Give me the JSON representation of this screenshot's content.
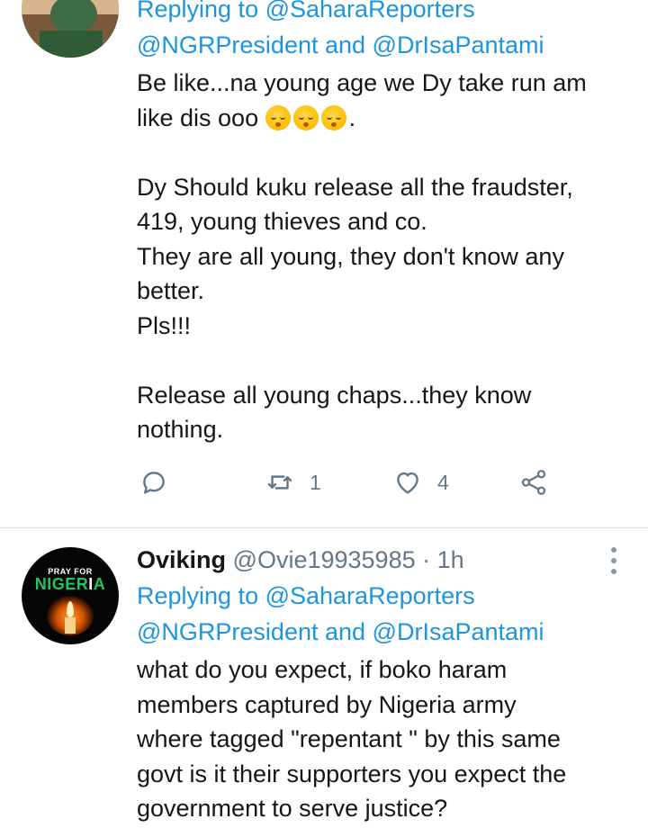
{
  "tweet1": {
    "reply_prefix": "Replying to ",
    "reply_handle1": "@SaharaReporters",
    "reply_handle2": "@NGRPresident",
    "reply_and": " and ",
    "reply_handle3": "@DrIsaPantami",
    "body_line1": "Be like...na young age we Dy take run am",
    "body_line2_prefix": "like dis ooo ",
    "body_line2_suffix": ".",
    "emoji_name": "kissing-face-with-closed-eyes",
    "body_rest": "\nDy Should kuku release all the fraudster,\n419, young thieves and co.\nThey are all young, they don't know any\nbetter.\nPls!!!\n\nRelease all young chaps...they know\nnothing.",
    "actions": {
      "reply_icon": "comment-icon",
      "retweet_icon": "retweet-icon",
      "retweet_count": "1",
      "like_icon": "heart-icon",
      "like_count": "4",
      "share_icon": "share-icon"
    }
  },
  "tweet2": {
    "display_name": "Oviking",
    "handle": "@Ovie19935985",
    "dot": " · ",
    "time": "1h",
    "reply_prefix": "Replying to ",
    "reply_handle1": "@SaharaReporters",
    "reply_handle2": "@NGRPresident",
    "reply_and": " and ",
    "reply_handle3": "@DrIsaPantami",
    "body": "what do you expect, if boko haram\nmembers captured by Nigeria army\nwhere tagged \"repentant \" by this same\ngovt is it their supporters you expect the\ngovernment to serve justice?",
    "avatar": {
      "small_text": "PRAY FOR",
      "big_text_a": "NIGER",
      "big_text_b": "I",
      "big_text_c": "A"
    }
  },
  "colors": {
    "link": "#1b95e0",
    "muted": "#657786",
    "text": "#14171a",
    "divider": "#d9dfe3"
  }
}
